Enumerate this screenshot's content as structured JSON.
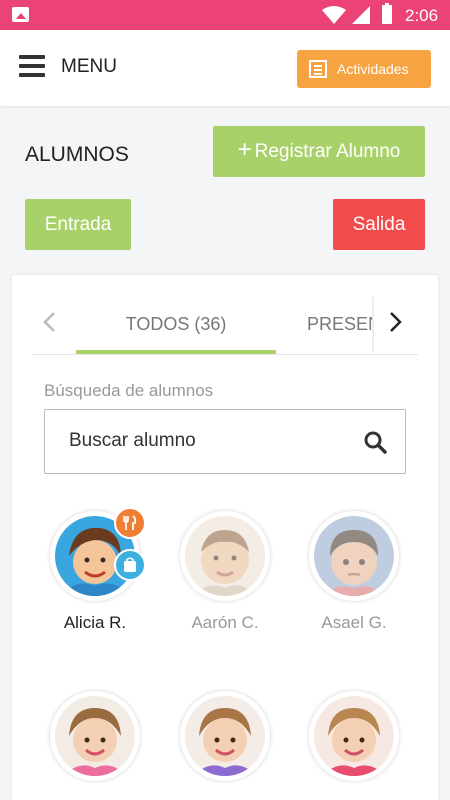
{
  "status_bar": {
    "time": "2:06",
    "colors": {
      "bar": "#ec4377"
    }
  },
  "header": {
    "menu_label": "MENU",
    "activities_button": "Actividades",
    "activities_color": "#f7a341"
  },
  "page": {
    "title": "ALUMNOS",
    "register_button": "Registrar Alumno",
    "register_plus": "+",
    "entry_button": "Entrada",
    "exit_button": "Salida",
    "colors": {
      "green": "#a9d16a",
      "red": "#f24b4b"
    }
  },
  "tabs": {
    "prev_icon": "chevron-left-icon",
    "next_icon": "chevron-right-icon",
    "items": [
      {
        "label": "TODOS (36)",
        "active": true
      },
      {
        "label": "PRESENTES",
        "active": false
      }
    ]
  },
  "search": {
    "label": "Búsqueda de alumnos",
    "placeholder": "Buscar alumno",
    "value": ""
  },
  "students": [
    {
      "name": "Alicia R.",
      "badges": [
        "food-icon",
        "bag-icon"
      ],
      "active": true
    },
    {
      "name": "Aarón C.",
      "badges": [],
      "active": false
    },
    {
      "name": "Asael G.",
      "badges": [],
      "active": false
    },
    {
      "name": "",
      "badges": [],
      "active": false
    },
    {
      "name": "",
      "badges": [],
      "active": false
    },
    {
      "name": "",
      "badges": [],
      "active": false
    }
  ]
}
